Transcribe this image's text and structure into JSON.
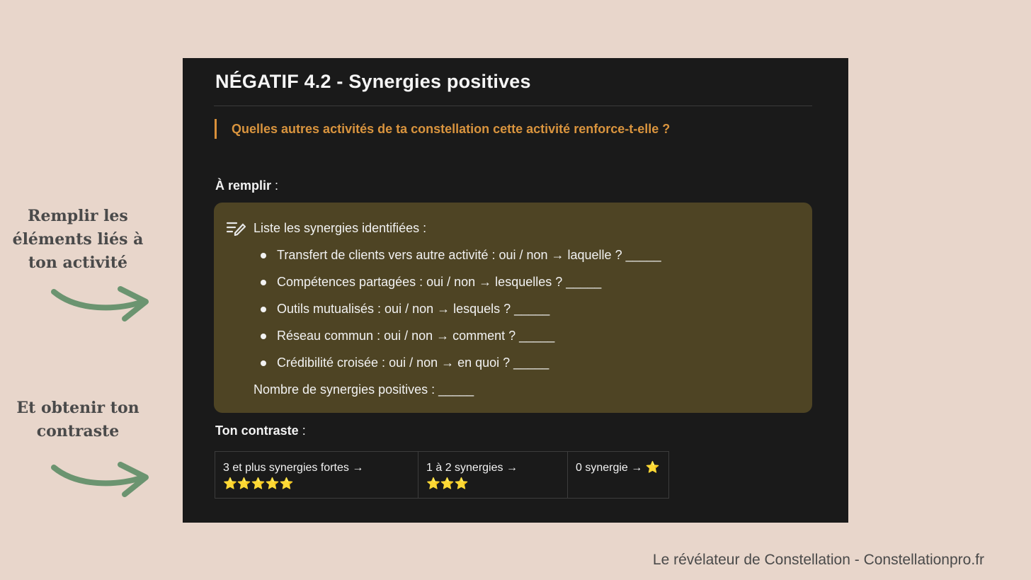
{
  "side_notes": {
    "fill": "Remplir les éléments liés à ton activité",
    "contrast": "Et obtenir ton contraste"
  },
  "panel": {
    "title": "NÉGATIF 4.2 - Synergies positives",
    "question": "Quelles autres activités de ta constellation cette activité renforce-t-elle ?",
    "fill_label": "À remplir",
    "fill_suffix": " :",
    "callout": {
      "icon": "edit-list-icon",
      "title": "Liste les synergies identifiées :",
      "items": [
        "Transfert de clients vers autre activité : oui / non → laquelle ? _____",
        "Compétences partagées : oui / non → lesquelles ? _____",
        "Outils mutualisés : oui / non → lesquels ? _____",
        "Réseau commun : oui / non → comment ? _____",
        "Crédibilité croisée : oui / non → en quoi ? _____"
      ],
      "footer": "Nombre de synergies positives : _____"
    },
    "contrast_label": "Ton contraste",
    "contrast_suffix": " :",
    "contrast_table": [
      "3 et plus synergies fortes → ⭐⭐⭐⭐⭐",
      "1 à 2 synergies → ⭐⭐⭐",
      "0 synergie → ⭐"
    ]
  },
  "footer": "Le révélateur de Constellation - Constellationpro.fr",
  "colors": {
    "background": "#e8d6cb",
    "panel": "#1a1a1a",
    "accent": "#d9943e",
    "callout": "#4e4424",
    "arrow": "#6b9470"
  }
}
